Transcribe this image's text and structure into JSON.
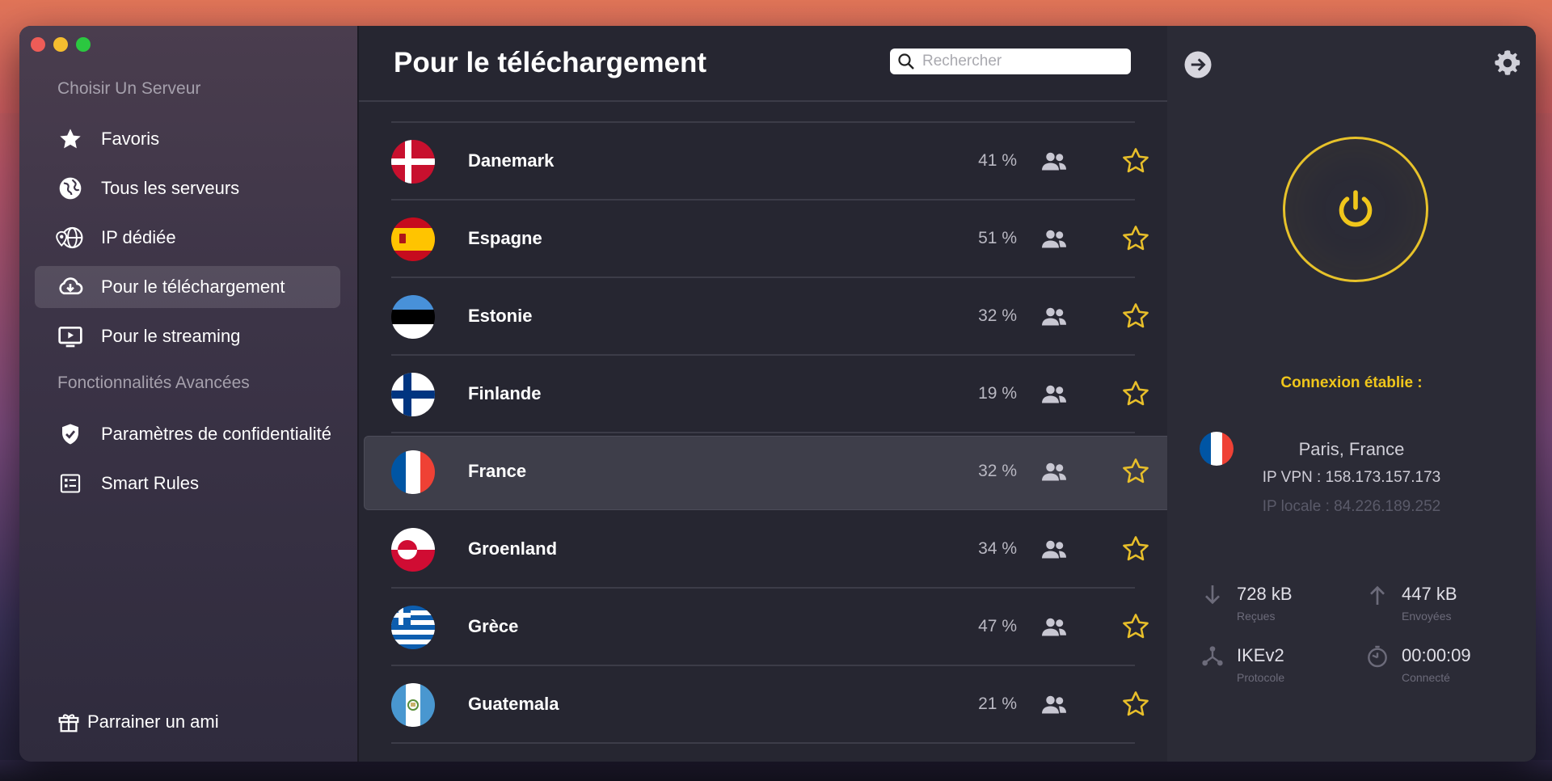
{
  "sidebar": {
    "section_servers": "Choisir Un Serveur",
    "items": [
      {
        "label": "Favoris",
        "icon": "star-icon"
      },
      {
        "label": "Tous les serveurs",
        "icon": "globe-icon"
      },
      {
        "label": "IP dédiée",
        "icon": "dedicated-ip-icon"
      },
      {
        "label": "Pour le téléchargement",
        "icon": "cloud-download-icon",
        "active": true
      },
      {
        "label": "Pour le streaming",
        "icon": "tv-play-icon"
      }
    ],
    "section_advanced": "Fonctionnalités Avancées",
    "advanced_items": [
      {
        "label": "Paramètres de confidentialité",
        "icon": "shield-check-icon"
      },
      {
        "label": "Smart Rules",
        "icon": "rules-list-icon"
      }
    ],
    "refer_label": "Parrainer un ami"
  },
  "main": {
    "title": "Pour le téléchargement",
    "search_placeholder": "Rechercher",
    "servers": [
      {
        "name": "Danemark",
        "load": "41 %",
        "flag": "dk"
      },
      {
        "name": "Espagne",
        "load": "51 %",
        "flag": "es"
      },
      {
        "name": "Estonie",
        "load": "32 %",
        "flag": "ee"
      },
      {
        "name": "Finlande",
        "load": "19 %",
        "flag": "fi"
      },
      {
        "name": "France",
        "load": "32 %",
        "flag": "fr",
        "selected": true
      },
      {
        "name": "Groenland",
        "load": "34 %",
        "flag": "gl"
      },
      {
        "name": "Grèce",
        "load": "47 %",
        "flag": "gr"
      },
      {
        "name": "Guatemala",
        "load": "21 %",
        "flag": "gt"
      }
    ]
  },
  "connection": {
    "status": "Connexion établie :",
    "location": "Paris, France",
    "vpn_ip": "IP VPN : 158.173.157.173",
    "local_ip": "IP locale : 84.226.189.252",
    "received_value": "728 kB",
    "received_label": "Reçues",
    "sent_value": "447 kB",
    "sent_label": "Envoyées",
    "protocol_value": "IKEv2",
    "protocol_label": "Protocole",
    "time_value": "00:00:09",
    "time_label": "Connecté"
  },
  "colors": {
    "accent_yellow": "#f0c61b",
    "star_yellow": "#e8bf2a",
    "window_bg": "#262631"
  }
}
